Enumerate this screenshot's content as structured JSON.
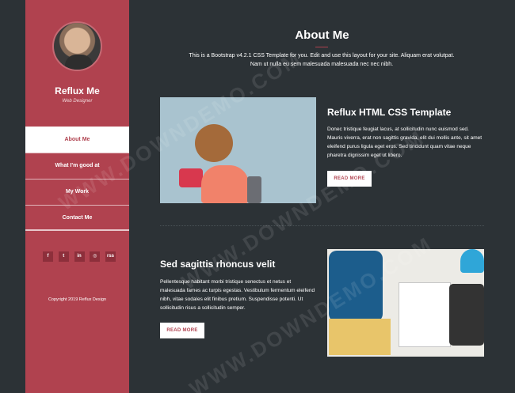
{
  "sidebar": {
    "name": "Reflux Me",
    "role": "Web Designer",
    "nav": [
      {
        "label": "About Me"
      },
      {
        "label": "What I'm good at"
      },
      {
        "label": "My Work"
      },
      {
        "label": "Contact Me"
      }
    ],
    "social": [
      "f",
      "t",
      "in",
      "◎",
      "rss"
    ],
    "copyright": "Copyright 2019 Reflux Design"
  },
  "header": {
    "title": "About Me",
    "intro_line1": "This is a Bootstrap v4.2.1 CSS Template for you. Edit and use this layout for your site. Aliquam erat volutpat.",
    "intro_line2": "Nam ut nulla eu sem malesuada malesuada nec nec nibh."
  },
  "cards": [
    {
      "title": "Reflux HTML CSS Template",
      "text": "Donec tristique feugiat lacus, at sollicitudin nunc euismod sed. Mauris viverra, erat non sagittis gravida, elit dui mollis ante, sit amet eleifend purus ligula eget eros. Sed tincidunt quam vitae neque pharetra dignissim eget ut libero.",
      "button": "READ MORE"
    },
    {
      "title": "Sed sagittis rhoncus velit",
      "text": "Pellentesque habitant morbi tristique senectus et netus et malesuada fames ac turpis egestas. Vestibulum fermentum eleifend nibh, vitae sodales elit finibus pretium. Suspendisse potenti. Ut sollicitudin risus a sollicitudin semper.",
      "button": "READ MORE"
    }
  ],
  "watermark": "WWW.DOWNDEMO.COM",
  "colors": {
    "accent": "#b0424f",
    "background": "#2c3236"
  }
}
